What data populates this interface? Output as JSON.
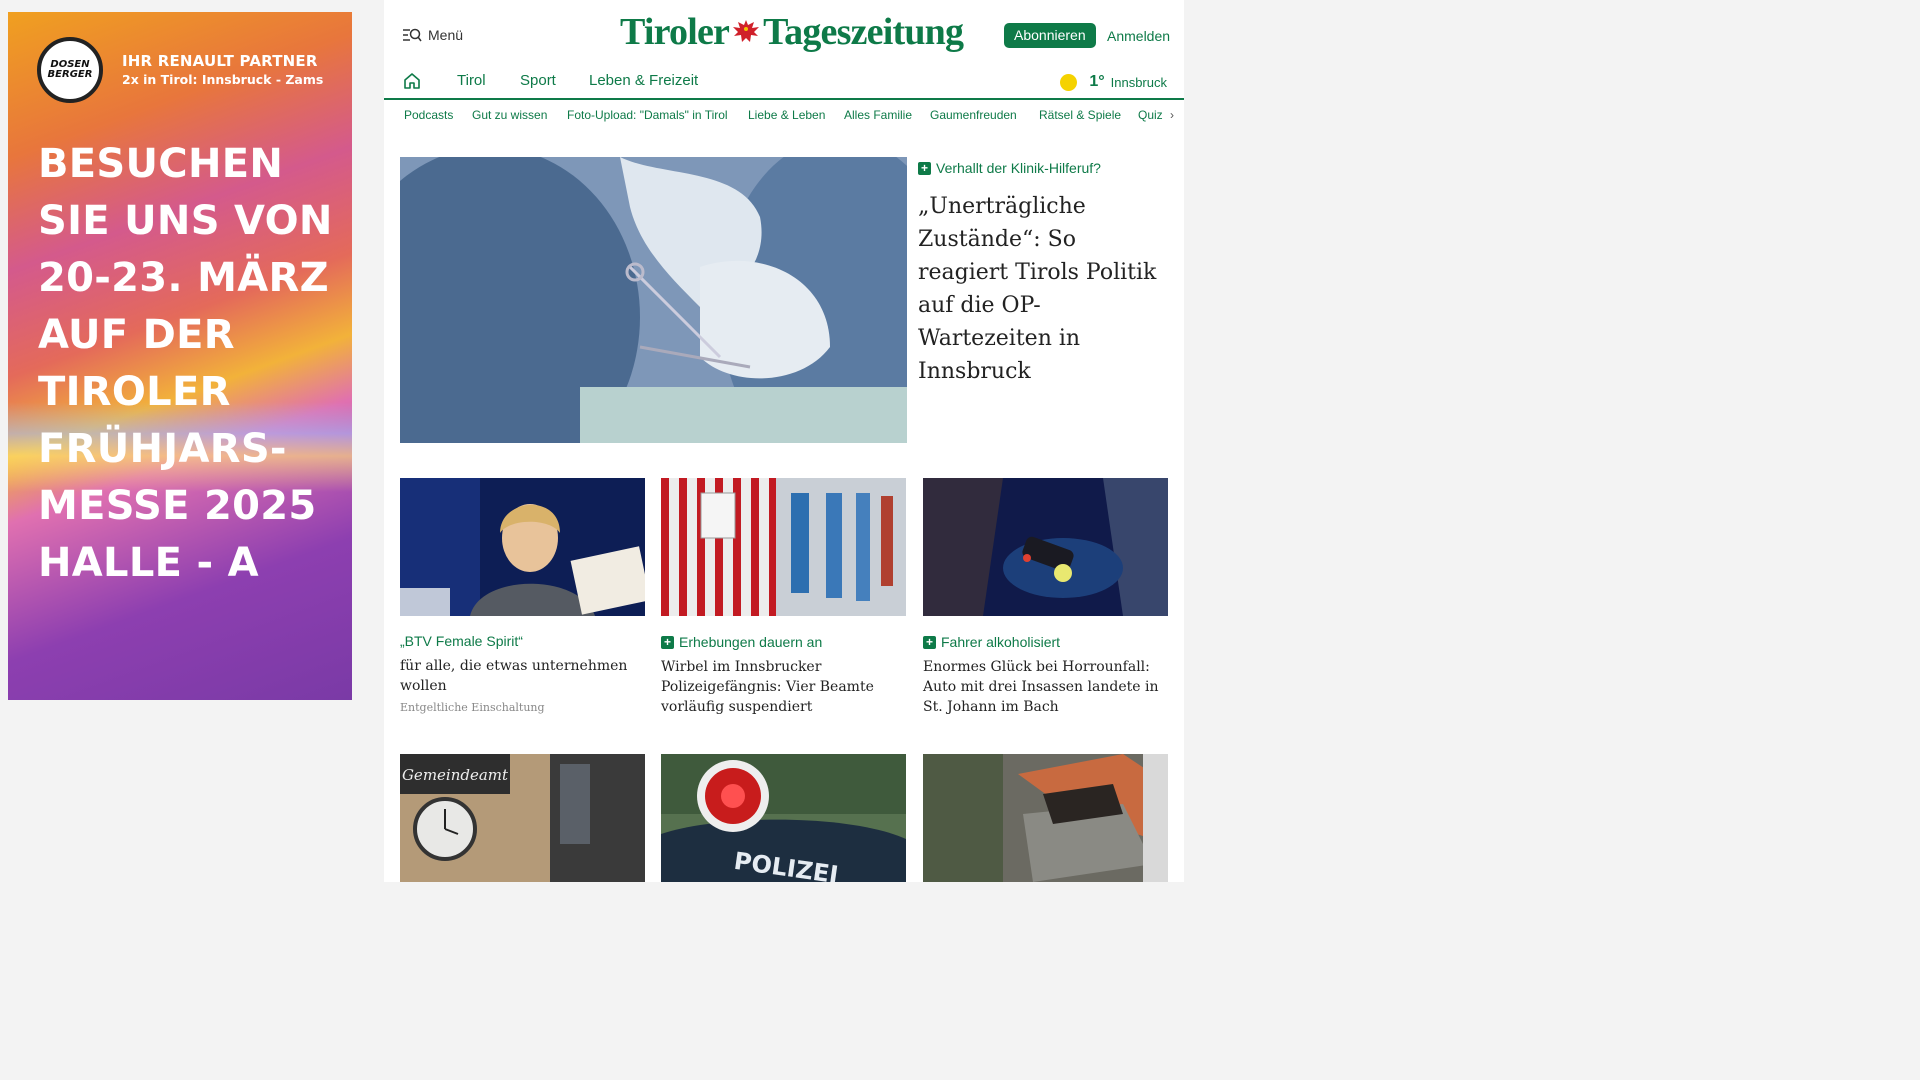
{
  "ad": {
    "logo_line1": "DOSEN",
    "logo_line2": "BERGER",
    "partner_line1": "IHR RENAULT PARTNER",
    "partner_line2": "2x in Tirol: Innsbruck - Zams",
    "headline": [
      "BESUCHEN",
      "SIE UNS VON",
      "20-23. MÄRZ",
      "AUF DER",
      "TIROLER",
      "FRÜHJARS-",
      "MESSE 2025",
      "HALLE - A"
    ]
  },
  "header": {
    "menu_label": "Menü",
    "logo_left": "Tiroler",
    "logo_right": "Tageszeitung",
    "subscribe_label": "Abonnieren",
    "login_label": "Anmelden"
  },
  "nav": {
    "tabs": [
      "Tirol",
      "Sport",
      "Leben & Freizeit"
    ],
    "weather_temp": "1°",
    "weather_city": "Innsbruck"
  },
  "subnav": {
    "items": [
      "Podcasts",
      "Gut zu wissen",
      "Foto-Upload: \"Damals\" in Tirol",
      "Liebe & Leben",
      "Alles Familie",
      "Gaumenfreuden",
      "Rätsel & Spiele",
      "Quiz"
    ]
  },
  "lead": {
    "kicker": "Verhallt der Klinik-Hilferuf?",
    "title": "„Unerträgliche Zustände“: So reagiert Tirols Politik auf die OP-Wartezeiten in Innsbruck"
  },
  "cards": [
    {
      "kicker": "„BTV Female Spirit“",
      "title": "für alle, die etwas unternehmen wollen",
      "note": "Entgeltliche Einschaltung"
    },
    {
      "kicker": "Erhebungen dauern an",
      "title": "Wirbel im Innsbrucker Polizeigefängnis: Vier Beamte vorläufig suspendiert"
    },
    {
      "kicker": "Fahrer alkoholisiert",
      "title": "Enormes Glück bei Horrounfall: Auto mit drei Insassen landete in St. Johann im Bach"
    }
  ],
  "images": {
    "sign_text": "Gemeindeamt",
    "police_text": "POLIZEI"
  },
  "colors": {
    "brand_green": "#0e7a48",
    "sun_yellow": "#f5d200"
  }
}
